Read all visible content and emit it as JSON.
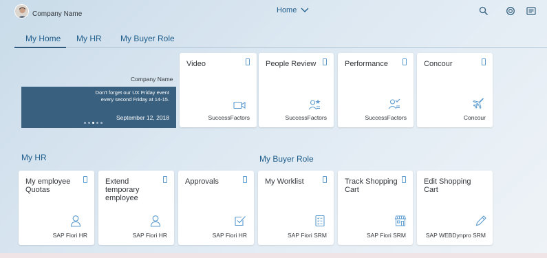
{
  "header": {
    "company_name": "Company Name",
    "home_label": "Home"
  },
  "tabs": [
    {
      "label": "My Home"
    },
    {
      "label": "My HR"
    },
    {
      "label": "My Buyer Role"
    }
  ],
  "news": {
    "company_name": "Company Name",
    "message_line1": "Don't forget our UX Friday event",
    "message_line2": "every second Friday at 14-15.",
    "date": "September 12, 2018"
  },
  "top_tiles": [
    {
      "title": "Video",
      "footer": "SuccessFactors",
      "icon": "video-camera-icon"
    },
    {
      "title": "People Review",
      "footer": "SuccessFactors",
      "icon": "person-review-icon"
    },
    {
      "title": "Performance",
      "footer": "SuccessFactors",
      "icon": "person-check-icon"
    },
    {
      "title": "Concour",
      "footer": "Concour",
      "icon": "airplane-icon"
    }
  ],
  "groups": {
    "my_hr": "My HR",
    "my_buyer_role": "My Buyer Role"
  },
  "hr_tiles": [
    {
      "title_line1": "My employee",
      "title_line2": "Quotas",
      "footer": "SAP Fiori  HR",
      "icon": "person-icon"
    },
    {
      "title_line1": "Extend temporary",
      "title_line2": "employee",
      "footer": "SAP Fiori HR",
      "icon": "person-icon"
    },
    {
      "title_line1": "Approvals",
      "title_line2": "",
      "footer": "SAP Fiori HR",
      "icon": "checkbox-icon"
    }
  ],
  "buyer_tiles": [
    {
      "title_line1": "My Worklist",
      "title_line2": "",
      "footer": "SAP Fiori SRM",
      "icon": "checklist-icon"
    },
    {
      "title_line1": "Track Shopping",
      "title_line2": "Cart",
      "footer": "SAP Fiori SRM",
      "icon": "store-icon"
    },
    {
      "title_line1": "Edit Shopping",
      "title_line2": "Cart",
      "footer": "SAP WEBDynpro SRM",
      "icon": "pencil-icon"
    }
  ],
  "colors": {
    "accent": "#1f5d8b",
    "icon_blue": "#5b9bd0",
    "news_panel": "#39607f"
  }
}
